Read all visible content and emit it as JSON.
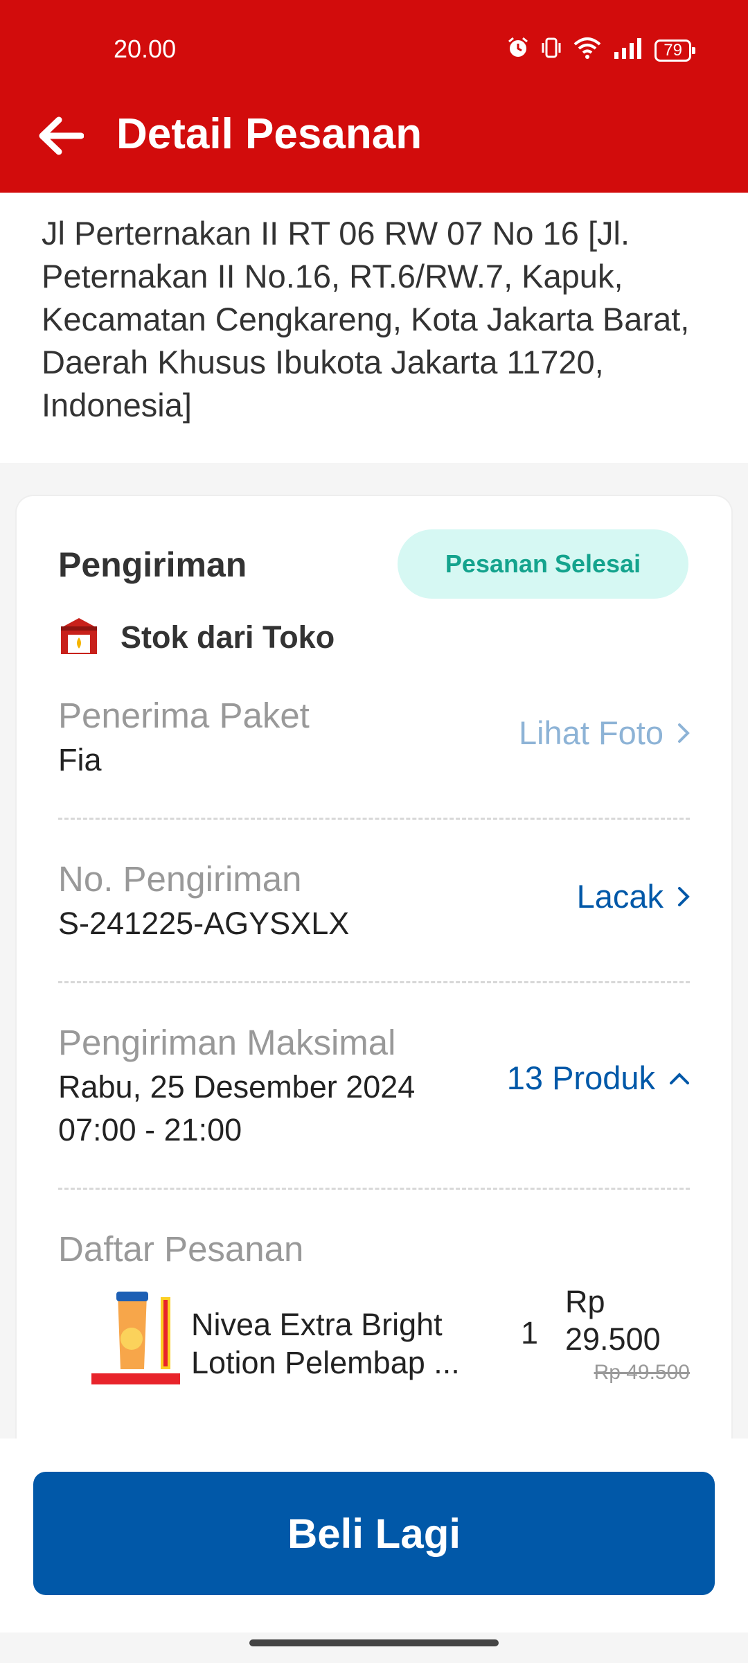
{
  "status_bar": {
    "time": "20.00",
    "battery": "79"
  },
  "header": {
    "title": "Detail Pesanan"
  },
  "address": {
    "text": "Jl Perternakan II RT 06 RW 07 No 16  [Jl. Peternakan II No.16, RT.6/RW.7, Kapuk, Kecamatan Cengkareng, Kota Jakarta Barat, Daerah Khusus Ibukota Jakarta 11720, Indonesia]"
  },
  "shipment": {
    "title": "Pengiriman",
    "status": "Pesanan Selesai",
    "store_label": "Stok dari Toko",
    "recipient": {
      "label": "Penerima Paket",
      "value": "Fia",
      "action": "Lihat Foto"
    },
    "tracking": {
      "label": "No. Pengiriman",
      "value": "S-241225-AGYSXLX",
      "action": "Lacak"
    },
    "delivery": {
      "label": "Pengiriman Maksimal",
      "date": "Rabu, 25 Desember 2024",
      "time": "07:00 - 21:00",
      "action": "13 Produk"
    },
    "orders": {
      "label": "Daftar Pesanan",
      "items": [
        {
          "name": "Nivea Extra Bright Lotion Pelembap ...",
          "qty": "1",
          "price_currency": "Rp",
          "price": "29.500",
          "old_price": "Rp 49.500"
        }
      ]
    }
  },
  "footer": {
    "buy_again": "Beli Lagi"
  },
  "colors": {
    "brand_red": "#d20c0c",
    "primary_blue": "#0158a8",
    "link_light_blue": "#8db3d6",
    "status_green": "#14a38d"
  }
}
